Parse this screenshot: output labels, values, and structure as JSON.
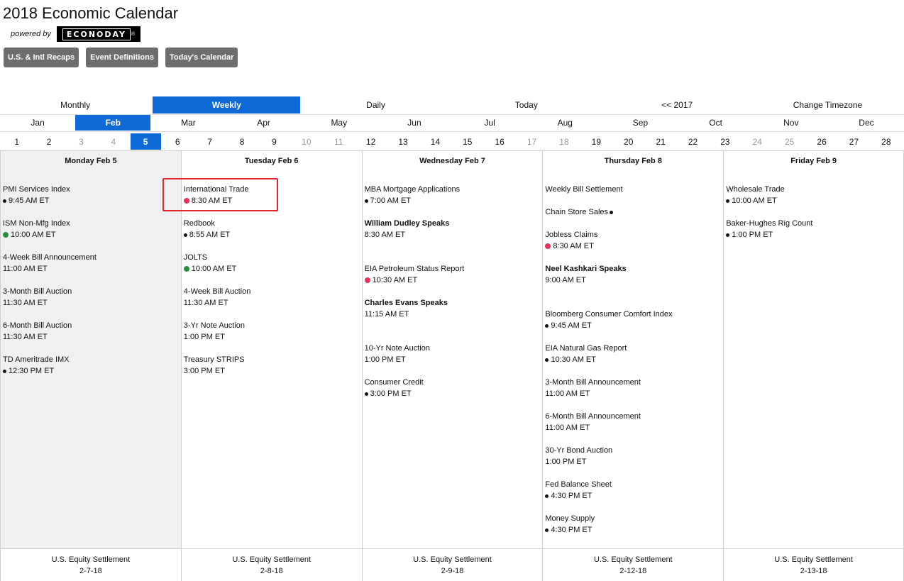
{
  "title": "2018 Economic Calendar",
  "powered_by": "powered by",
  "logo_text": "ECONODAY",
  "logo_mark": "®",
  "top_buttons": [
    "U.S. & Intl Recaps",
    "Event Definitions",
    "Today's Calendar"
  ],
  "views": [
    "Monthly",
    "Weekly",
    "Daily",
    "Today",
    "<< 2017",
    "Change Timezone"
  ],
  "active_view": "Weekly",
  "months": [
    "Jan",
    "Feb",
    "Mar",
    "Apr",
    "May",
    "Jun",
    "Jul",
    "Aug",
    "Sep",
    "Oct",
    "Nov",
    "Dec"
  ],
  "active_month": "Feb",
  "days": [
    "1",
    "2",
    "3",
    "4",
    "5",
    "6",
    "7",
    "8",
    "9",
    "10",
    "11",
    "12",
    "13",
    "14",
    "15",
    "16",
    "17",
    "18",
    "19",
    "20",
    "21",
    "22",
    "23",
    "24",
    "25",
    "26",
    "27",
    "28"
  ],
  "weekend_days": [
    "3",
    "4",
    "10",
    "11",
    "17",
    "18",
    "24",
    "25"
  ],
  "active_day": "5",
  "colors": {
    "accent": "#0f6ad8",
    "red_dot": "#e8315a",
    "green_dot": "#2a8c3e",
    "highlight": "#e0262a"
  },
  "week": [
    {
      "header": "Monday Feb 5",
      "events": [
        {
          "name": "PMI Services Index",
          "time": "9:45 AM ET",
          "dot": "black"
        },
        {
          "name": "ISM Non-Mfg Index",
          "time": "10:00 AM ET",
          "dot": "green"
        },
        {
          "name": "4-Week Bill Announcement",
          "time": "11:00 AM ET",
          "dot": ""
        },
        {
          "name": "3-Month Bill Auction",
          "time": "11:30 AM ET",
          "dot": ""
        },
        {
          "name": "6-Month Bill Auction",
          "time": "11:30 AM ET",
          "dot": ""
        },
        {
          "name": "TD Ameritrade IMX",
          "time": "12:30 PM ET",
          "dot": "black"
        }
      ],
      "footer": [
        "U.S. Equity Settlement",
        "2-7-18"
      ]
    },
    {
      "header": "Tuesday Feb 6",
      "events": [
        {
          "name": "International Trade",
          "time": "8:30 AM ET",
          "dot": "red"
        },
        {
          "name": "Redbook",
          "time": "8:55 AM ET",
          "dot": "black"
        },
        {
          "name": "JOLTS",
          "time": "10:00 AM ET",
          "dot": "green"
        },
        {
          "name": "4-Week Bill Auction",
          "time": "11:30 AM ET",
          "dot": ""
        },
        {
          "name": "3-Yr Note Auction",
          "time": "1:00 PM ET",
          "dot": ""
        },
        {
          "name": "Treasury STRIPS",
          "time": "3:00 PM ET",
          "dot": ""
        }
      ],
      "footer": [
        "U.S. Equity Settlement",
        "2-8-18"
      ]
    },
    {
      "header": "Wednesday Feb 7",
      "events": [
        {
          "name": "MBA Mortgage Applications",
          "time": "7:00 AM ET",
          "dot": "black"
        },
        {
          "name": "William Dudley Speaks",
          "time": "8:30 AM ET",
          "dot": "",
          "bold": true
        },
        {
          "name": "EIA Petroleum Status Report",
          "time": "10:30 AM ET",
          "dot": "red",
          "gap": true
        },
        {
          "name": "Charles Evans Speaks",
          "time": "11:15 AM ET",
          "dot": "",
          "bold": true
        },
        {
          "name": "10-Yr Note Auction",
          "time": "1:00 PM ET",
          "dot": "",
          "gap": true
        },
        {
          "name": "Consumer Credit",
          "time": "3:00 PM ET",
          "dot": "black"
        }
      ],
      "footer": [
        "U.S. Equity Settlement",
        "2-9-18"
      ]
    },
    {
      "header": "Thursday Feb 8",
      "events": [
        {
          "name": "Weekly Bill Settlement",
          "time": "",
          "dot": ""
        },
        {
          "name": "Chain Store Sales",
          "time": "",
          "dot": "black-after"
        },
        {
          "name": "Jobless Claims",
          "time": "8:30 AM ET",
          "dot": "red"
        },
        {
          "name": "Neel Kashkari Speaks",
          "time": "9:00 AM ET",
          "dot": "",
          "bold": true
        },
        {
          "name": "Bloomberg Consumer Comfort Index",
          "time": "9:45 AM ET",
          "dot": "black",
          "gap": true
        },
        {
          "name": "EIA Natural Gas Report",
          "time": "10:30 AM ET",
          "dot": "black"
        },
        {
          "name": "3-Month Bill Announcement",
          "time": "11:00 AM ET",
          "dot": ""
        },
        {
          "name": "6-Month Bill Announcement",
          "time": "11:00 AM ET",
          "dot": ""
        },
        {
          "name": "30-Yr Bond Auction",
          "time": "1:00 PM ET",
          "dot": ""
        },
        {
          "name": "Fed Balance Sheet",
          "time": "4:30 PM ET",
          "dot": "black"
        },
        {
          "name": "Money Supply",
          "time": "4:30 PM ET",
          "dot": "black"
        }
      ],
      "footer": [
        "U.S. Equity Settlement",
        "2-12-18"
      ]
    },
    {
      "header": "Friday Feb 9",
      "events": [
        {
          "name": "Wholesale Trade",
          "time": "10:00 AM ET",
          "dot": "black"
        },
        {
          "name": "Baker-Hughes Rig Count",
          "time": "1:00 PM ET",
          "dot": "black"
        }
      ],
      "footer": [
        "U.S. Equity Settlement",
        "2-13-18"
      ]
    }
  ]
}
